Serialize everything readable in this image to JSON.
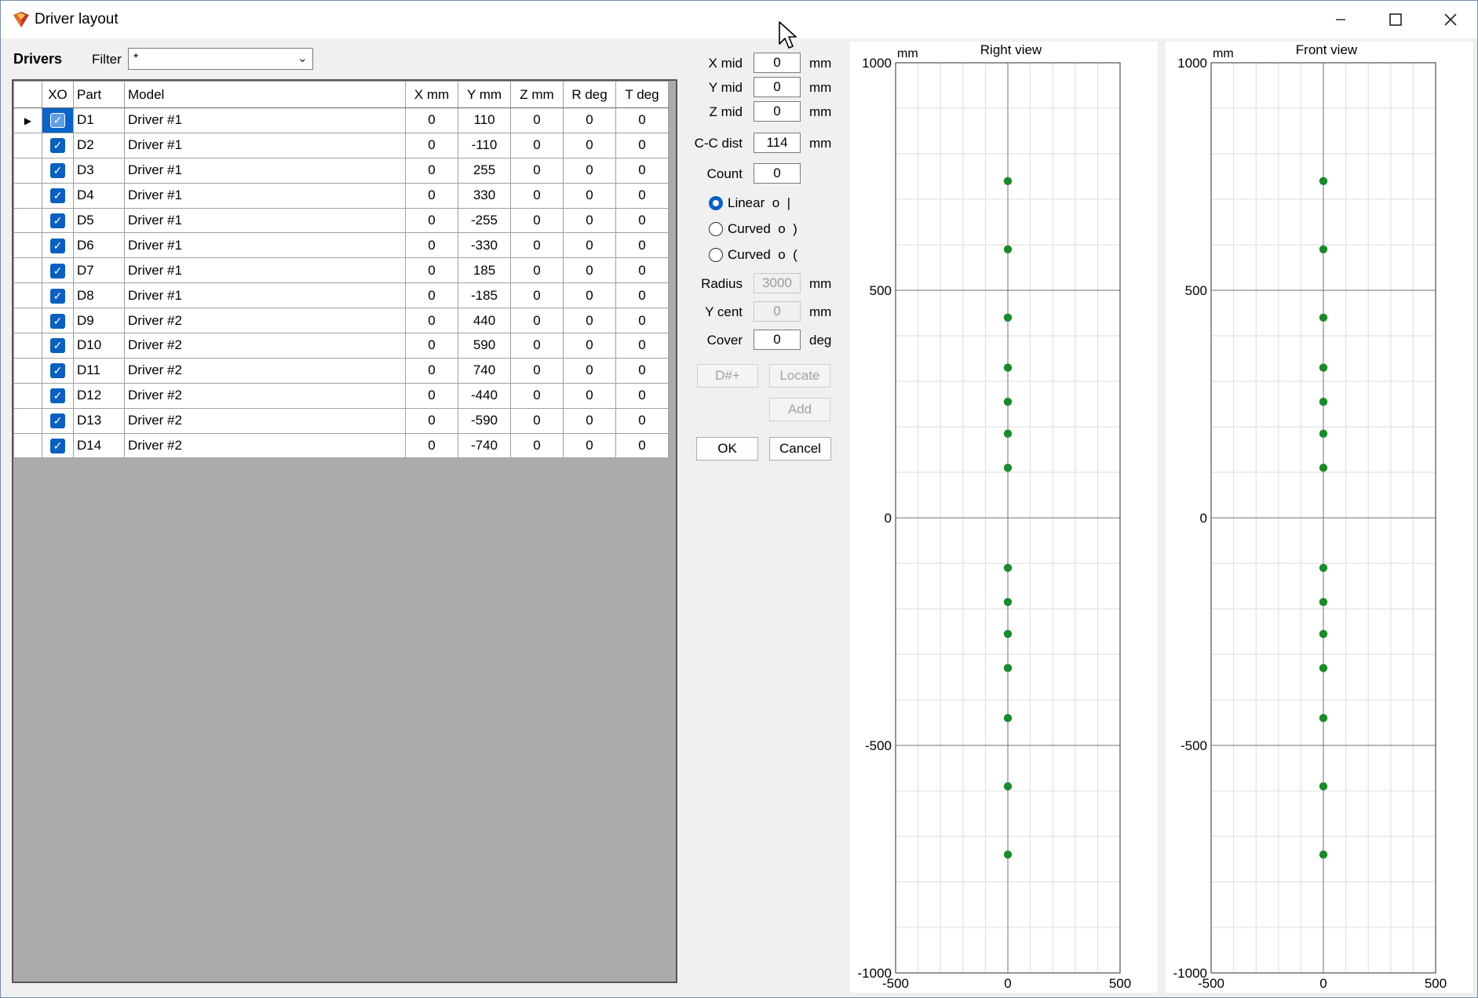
{
  "window": {
    "title": "Driver layout"
  },
  "icons": {
    "app": "app-logo-icon",
    "minimize": "minimize-icon",
    "maximize": "maximize-icon",
    "close": "close-icon",
    "cursor": "mouse-pointer-icon"
  },
  "toolbar": {
    "drivers_label": "Drivers",
    "filter_label": "Filter",
    "filter_value": "*"
  },
  "grid": {
    "columns": [
      "XO",
      "Part",
      "Model",
      "X mm",
      "Y mm",
      "Z mm",
      "R deg",
      "T deg"
    ],
    "rows": [
      {
        "part": "D1",
        "model": "Driver #1",
        "x": "0",
        "y": "110",
        "z": "0",
        "r": "0",
        "t": "0"
      },
      {
        "part": "D2",
        "model": "Driver #1",
        "x": "0",
        "y": "-110",
        "z": "0",
        "r": "0",
        "t": "0"
      },
      {
        "part": "D3",
        "model": "Driver #1",
        "x": "0",
        "y": "255",
        "z": "0",
        "r": "0",
        "t": "0"
      },
      {
        "part": "D4",
        "model": "Driver #1",
        "x": "0",
        "y": "330",
        "z": "0",
        "r": "0",
        "t": "0"
      },
      {
        "part": "D5",
        "model": "Driver #1",
        "x": "0",
        "y": "-255",
        "z": "0",
        "r": "0",
        "t": "0"
      },
      {
        "part": "D6",
        "model": "Driver #1",
        "x": "0",
        "y": "-330",
        "z": "0",
        "r": "0",
        "t": "0"
      },
      {
        "part": "D7",
        "model": "Driver #1",
        "x": "0",
        "y": "185",
        "z": "0",
        "r": "0",
        "t": "0"
      },
      {
        "part": "D8",
        "model": "Driver #1",
        "x": "0",
        "y": "-185",
        "z": "0",
        "r": "0",
        "t": "0"
      },
      {
        "part": "D9",
        "model": "Driver #2",
        "x": "0",
        "y": "440",
        "z": "0",
        "r": "0",
        "t": "0"
      },
      {
        "part": "D10",
        "model": "Driver #2",
        "x": "0",
        "y": "590",
        "z": "0",
        "r": "0",
        "t": "0"
      },
      {
        "part": "D11",
        "model": "Driver #2",
        "x": "0",
        "y": "740",
        "z": "0",
        "r": "0",
        "t": "0"
      },
      {
        "part": "D12",
        "model": "Driver #2",
        "x": "0",
        "y": "-440",
        "z": "0",
        "r": "0",
        "t": "0"
      },
      {
        "part": "D13",
        "model": "Driver #2",
        "x": "0",
        "y": "-590",
        "z": "0",
        "r": "0",
        "t": "0"
      },
      {
        "part": "D14",
        "model": "Driver #2",
        "x": "0",
        "y": "-740",
        "z": "0",
        "r": "0",
        "t": "0"
      }
    ]
  },
  "controls": {
    "x_mid": {
      "label": "X mid",
      "value": "0",
      "unit": "mm"
    },
    "y_mid": {
      "label": "Y mid",
      "value": "0",
      "unit": "mm"
    },
    "z_mid": {
      "label": "Z mid",
      "value": "0",
      "unit": "mm"
    },
    "cc_dist": {
      "label": "C-C dist",
      "value": "114",
      "unit": "mm"
    },
    "count": {
      "label": "Count",
      "value": "0"
    },
    "radio_linear": "Linear  o  |",
    "radio_curved1": "Curved  o  )",
    "radio_curved2": "Curved  o  (",
    "radius": {
      "label": "Radius",
      "value": "3000",
      "unit": "mm"
    },
    "y_cent": {
      "label": "Y cent",
      "value": "0",
      "unit": "mm"
    },
    "cover": {
      "label": "Cover",
      "value": "0",
      "unit": "deg"
    },
    "dnum_button": "D#+",
    "locate_button": "Locate",
    "add_button": "Add",
    "ok_button": "OK",
    "cancel_button": "Cancel"
  },
  "chart_data": [
    {
      "type": "scatter",
      "title": "Right view",
      "ylabel": "mm",
      "xlim": [
        -500,
        500
      ],
      "ylim": [
        -1000,
        1000
      ],
      "x_ticks": [
        "-500",
        "0",
        "500"
      ],
      "y_ticks": [
        "1000",
        "500",
        "0",
        "-500",
        "-1000"
      ],
      "grid": true,
      "color": "#1a8a2a",
      "points": [
        [
          0,
          740
        ],
        [
          0,
          590
        ],
        [
          0,
          440
        ],
        [
          0,
          330
        ],
        [
          0,
          255
        ],
        [
          0,
          185
        ],
        [
          0,
          110
        ],
        [
          0,
          -110
        ],
        [
          0,
          -185
        ],
        [
          0,
          -255
        ],
        [
          0,
          -330
        ],
        [
          0,
          -440
        ],
        [
          0,
          -590
        ],
        [
          0,
          -740
        ]
      ]
    },
    {
      "type": "scatter",
      "title": "Front view",
      "ylabel": "mm",
      "xlim": [
        -500,
        500
      ],
      "ylim": [
        -1000,
        1000
      ],
      "x_ticks": [
        "-500",
        "0",
        "500"
      ],
      "y_ticks": [
        "1000",
        "500",
        "0",
        "-500",
        "-1000"
      ],
      "grid": true,
      "color": "#1a8a2a",
      "points": [
        [
          0,
          740
        ],
        [
          0,
          590
        ],
        [
          0,
          440
        ],
        [
          0,
          330
        ],
        [
          0,
          255
        ],
        [
          0,
          185
        ],
        [
          0,
          110
        ],
        [
          0,
          -110
        ],
        [
          0,
          -185
        ],
        [
          0,
          -255
        ],
        [
          0,
          -330
        ],
        [
          0,
          -440
        ],
        [
          0,
          -590
        ],
        [
          0,
          -740
        ]
      ]
    }
  ]
}
